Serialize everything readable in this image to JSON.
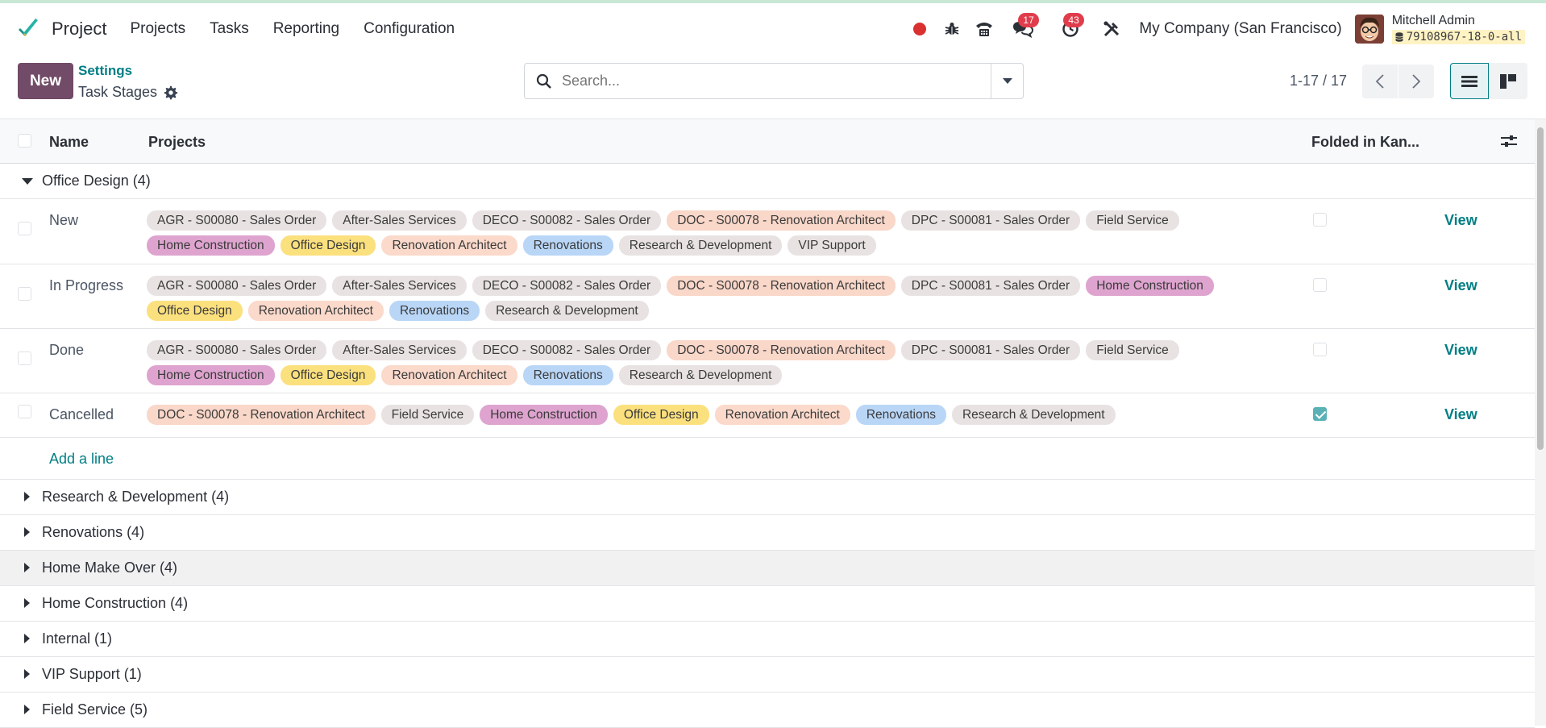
{
  "navbar": {
    "app_name": "Project",
    "menu": [
      {
        "label": "Projects"
      },
      {
        "label": "Tasks"
      },
      {
        "label": "Reporting"
      },
      {
        "label": "Configuration"
      }
    ],
    "messages_count": "17",
    "activities_count": "43",
    "company": "My Company (San Francisco)",
    "user_name": "Mitchell Admin",
    "db_name": "79108967-18-0-all"
  },
  "control_panel": {
    "new_label": "New",
    "breadcrumb": "Settings",
    "title": "Task Stages",
    "search_placeholder": "Search...",
    "pager": "1-17 / 17"
  },
  "table": {
    "headers": {
      "name": "Name",
      "projects": "Projects",
      "folded": "Folded in Kan..."
    },
    "view_label": "View",
    "add_line_label": "Add a line"
  },
  "tag_colors": {
    "grey": "#e8e3e2",
    "salmon": "#f9d7c9",
    "pink": "#dea4cf",
    "yellow": "#fbe07e",
    "peach": "#fbd9cb",
    "blue": "#b9d6f7"
  },
  "groups": [
    {
      "label": "Office Design (4)",
      "expanded": true,
      "rows": [
        {
          "name": "New",
          "folded": false,
          "tags": [
            {
              "label": "AGR - S00080 - Sales Order",
              "color": "grey"
            },
            {
              "label": "After-Sales Services",
              "color": "grey"
            },
            {
              "label": "DECO - S00082 - Sales Order",
              "color": "grey"
            },
            {
              "label": "DOC - S00078 - Renovation Architect",
              "color": "salmon"
            },
            {
              "label": "DPC - S00081 - Sales Order",
              "color": "grey"
            },
            {
              "label": "Field Service",
              "color": "grey"
            },
            {
              "label": "Home Construction",
              "color": "pink"
            },
            {
              "label": "Office Design",
              "color": "yellow"
            },
            {
              "label": "Renovation Architect",
              "color": "peach"
            },
            {
              "label": "Renovations",
              "color": "blue"
            },
            {
              "label": "Research & Development",
              "color": "grey"
            },
            {
              "label": "VIP Support",
              "color": "grey"
            }
          ]
        },
        {
          "name": "In Progress",
          "folded": false,
          "tags": [
            {
              "label": "AGR - S00080 - Sales Order",
              "color": "grey"
            },
            {
              "label": "After-Sales Services",
              "color": "grey"
            },
            {
              "label": "DECO - S00082 - Sales Order",
              "color": "grey"
            },
            {
              "label": "DOC - S00078 - Renovation Architect",
              "color": "salmon"
            },
            {
              "label": "DPC - S00081 - Sales Order",
              "color": "grey"
            },
            {
              "label": "Home Construction",
              "color": "pink"
            },
            {
              "label": "Office Design",
              "color": "yellow"
            },
            {
              "label": "Renovation Architect",
              "color": "peach"
            },
            {
              "label": "Renovations",
              "color": "blue"
            },
            {
              "label": "Research & Development",
              "color": "grey"
            }
          ]
        },
        {
          "name": "Done",
          "folded": false,
          "tags": [
            {
              "label": "AGR - S00080 - Sales Order",
              "color": "grey"
            },
            {
              "label": "After-Sales Services",
              "color": "grey"
            },
            {
              "label": "DECO - S00082 - Sales Order",
              "color": "grey"
            },
            {
              "label": "DOC - S00078 - Renovation Architect",
              "color": "salmon"
            },
            {
              "label": "DPC - S00081 - Sales Order",
              "color": "grey"
            },
            {
              "label": "Field Service",
              "color": "grey"
            },
            {
              "label": "Home Construction",
              "color": "pink"
            },
            {
              "label": "Office Design",
              "color": "yellow"
            },
            {
              "label": "Renovation Architect",
              "color": "peach"
            },
            {
              "label": "Renovations",
              "color": "blue"
            },
            {
              "label": "Research & Development",
              "color": "grey"
            }
          ]
        },
        {
          "name": "Cancelled",
          "folded": true,
          "tags": [
            {
              "label": "DOC - S00078 - Renovation Architect",
              "color": "salmon"
            },
            {
              "label": "Field Service",
              "color": "grey"
            },
            {
              "label": "Home Construction",
              "color": "pink"
            },
            {
              "label": "Office Design",
              "color": "yellow"
            },
            {
              "label": "Renovation Architect",
              "color": "peach"
            },
            {
              "label": "Renovations",
              "color": "blue"
            },
            {
              "label": "Research & Development",
              "color": "grey"
            }
          ]
        }
      ]
    },
    {
      "label": "Research & Development (4)",
      "expanded": false
    },
    {
      "label": "Renovations (4)",
      "expanded": false
    },
    {
      "label": "Home Make Over (4)",
      "expanded": false,
      "highlighted": true
    },
    {
      "label": "Home Construction (4)",
      "expanded": false
    },
    {
      "label": "Internal (1)",
      "expanded": false
    },
    {
      "label": "VIP Support (1)",
      "expanded": false
    },
    {
      "label": "Field Service (5)",
      "expanded": false
    }
  ]
}
